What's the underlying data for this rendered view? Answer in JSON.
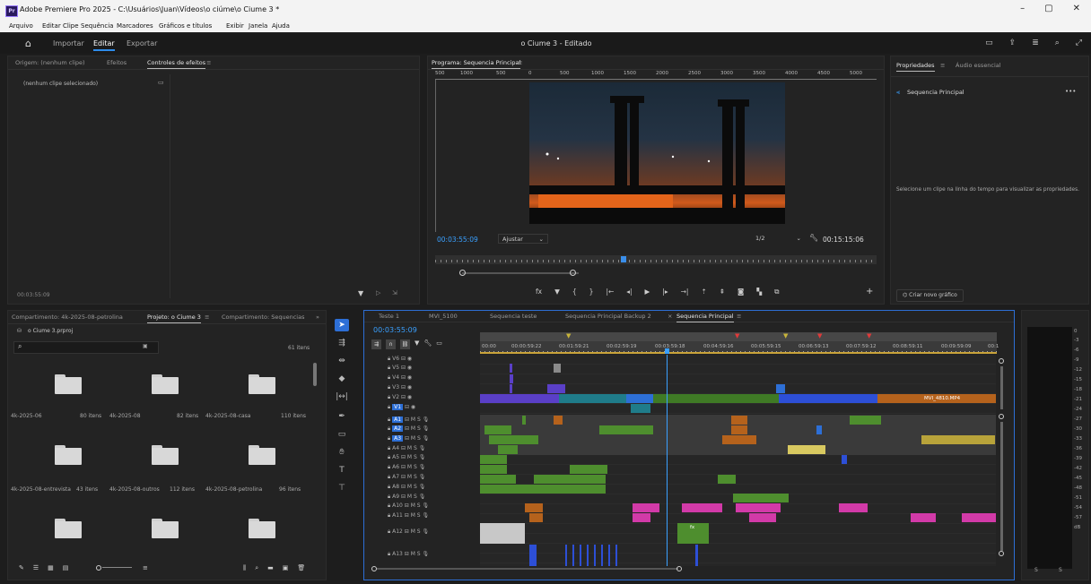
{
  "window": {
    "title": "Adobe Premiere Pro 2025 - C:\\Usuários\\Juan\\Vídeos\\o ciúme\\o Ciume 3 *",
    "app_badge": "Pr",
    "controls": [
      "–",
      "▢",
      "✕"
    ]
  },
  "menu": [
    "Arquivo",
    "Editar",
    "Clipe",
    "Sequência",
    "Marcadores",
    "Gráficos e títulos",
    "Exibir",
    "Janela",
    "Ajuda"
  ],
  "workspaces": {
    "home_icon": "home-icon",
    "tabs": [
      "Importar",
      "Editar",
      "Exportar"
    ],
    "active": "Editar",
    "center_title": "o Ciume 3 - Editado"
  },
  "source_panel": {
    "tabs": [
      "Origem: (nenhum clipe)",
      "Efeitos",
      "Controles de efeitos"
    ],
    "active": "Controles de efeitos",
    "no_clip": "(nenhum clipe selecionado)",
    "timecode": "00:03:55:09"
  },
  "program_monitor": {
    "tab": "Programa: Sequencia Principal",
    "ruler": [
      "500",
      "1000",
      "500",
      "0",
      "500",
      "1000",
      "1500",
      "2000",
      "2500",
      "3000",
      "3500",
      "4000",
      "4500",
      "5000"
    ],
    "timecode": "00:03:55:09",
    "fit": "Ajustar",
    "quality": "1/2",
    "duration": "00:15:15:06",
    "playhead_fraction": 0.42
  },
  "properties_panel": {
    "tabs": [
      "Propriedades",
      "Áudio essencial"
    ],
    "active": "Propriedades",
    "sequence": "Sequencia Principal",
    "more": "•••",
    "hint": "Selecione um clipe na linha do tempo para visualizar as propriedades.",
    "new_graphic": "Criar novo gráfico"
  },
  "project_panel": {
    "tabs": [
      "Compartimento: 4k-2025-08-petrolina",
      "Projeto: o Ciume 3",
      "Compartimento: Sequencias"
    ],
    "active": "Projeto: o Ciume 3",
    "file": "o Ciume 3.prproj",
    "item_count": "61 itens",
    "folders": [
      {
        "name": "4k-2025-06",
        "count": "80 itens"
      },
      {
        "name": "4k-2025-08",
        "count": "82 itens"
      },
      {
        "name": "4k-2025-08-casa",
        "count": "110 itens"
      },
      {
        "name": "4k-2025-08-entrevista",
        "count": "43 itens"
      },
      {
        "name": "4k-2025-08-outros",
        "count": "112 itens"
      },
      {
        "name": "4k-2025-08-petrolina",
        "count": "96 itens"
      },
      {
        "name": "",
        "count": ""
      },
      {
        "name": "",
        "count": ""
      },
      {
        "name": "",
        "count": ""
      }
    ]
  },
  "timeline": {
    "tabs": [
      "Teste 1",
      "MVI_5100",
      "Sequencia teste",
      "Sequencia Principal Backup 2",
      "Sequencia Principal"
    ],
    "active": "Sequencia Principal",
    "timecode": "00:03:55:09",
    "ruler": [
      "00:00",
      "00:00:59:22",
      "00:01:59:21",
      "00:02:59:19",
      "00:03:59:18",
      "00:04:59:16",
      "00:05:59:15",
      "00:06:59:13",
      "00:07:59:12",
      "00:08:59:11",
      "00:09:59:09",
      "00:1"
    ],
    "video_tracks": [
      "V6",
      "V5",
      "V4",
      "V3",
      "V2",
      "V1"
    ],
    "audio_tracks": [
      "A1",
      "A2",
      "A3",
      "A4",
      "A5",
      "A6",
      "A7",
      "A8",
      "A9",
      "A10",
      "A11",
      "A12",
      "A13"
    ],
    "clip_label": "MVI_4810.MP4",
    "fx_label": "fx"
  },
  "audio_meter": {
    "scale": [
      "0",
      "-3",
      "-6",
      "-9",
      "-12",
      "-15",
      "-18",
      "-21",
      "-24",
      "-27",
      "-30",
      "-33",
      "-36",
      "-39",
      "-42",
      "-45",
      "-48",
      "-51",
      "-54",
      "-57",
      "dB"
    ],
    "solo": [
      "S",
      "S"
    ]
  },
  "colors": {
    "accent": "#2d8ceb",
    "video_purple": "#5a3fc7",
    "video_teal": "#1f7c8a",
    "video_green": "#3f7a25",
    "audio_green": "#4e8e2e",
    "audio_pink": "#d23aa8",
    "orange": "#b5621c"
  }
}
